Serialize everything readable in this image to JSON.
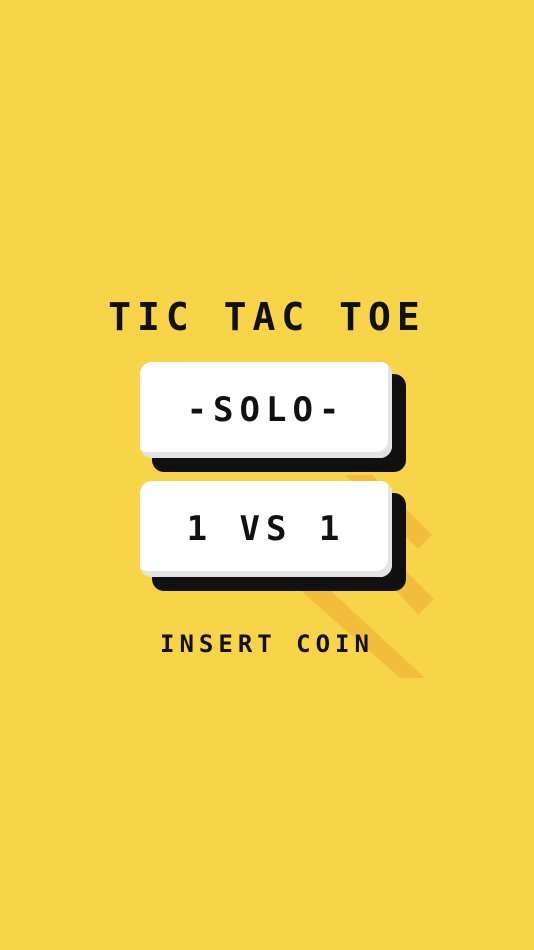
{
  "game": {
    "title": "TIC TAC TOE",
    "buttons": {
      "solo": "-SOLO-",
      "versus": "1 VS 1"
    },
    "footer_text": "INSERT COIN"
  },
  "colors": {
    "background": "#f8d548",
    "stripe": "#f2bd3d",
    "text": "#111111",
    "button": "#ffffff",
    "button_shadow": "#111111"
  }
}
